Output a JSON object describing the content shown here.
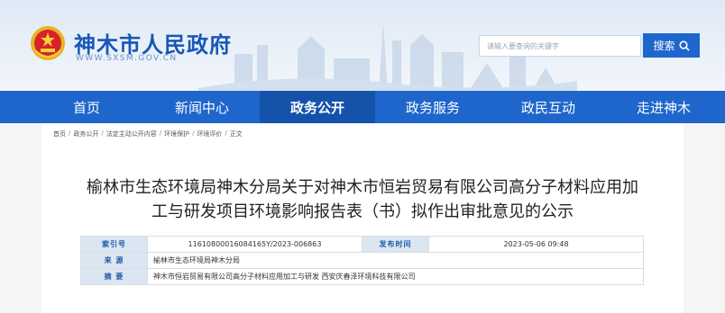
{
  "site": {
    "name": "神木市人民政府",
    "url": "WWW.SXSM.GOV.CN",
    "emblem_icon": "national-emblem-icon"
  },
  "search": {
    "placeholder": "请输入要查询的关键字",
    "button_label": "搜索",
    "icon": "search-icon"
  },
  "nav": {
    "items": [
      {
        "label": "首页"
      },
      {
        "label": "新闻中心"
      },
      {
        "label": "政务公开"
      },
      {
        "label": "政务服务"
      },
      {
        "label": "政民互动"
      },
      {
        "label": "走进神木"
      }
    ],
    "active_index": 2
  },
  "breadcrumb": {
    "items": [
      "首页",
      "政务公开",
      "法定主动公开内容",
      "环境保护",
      "环境评价",
      "正文"
    ],
    "separator": "/"
  },
  "article": {
    "title_line1": "榆林市生态环境局神木分局关于对神木市恒岩贸易有限公司高分子材料应用加",
    "title_line2": "工与研发项目环境影响报告表（书）拟作出审批意见的公示"
  },
  "meta": {
    "index_label": "索引号",
    "index_value": "11610800016084165Y/2023-006863",
    "date_label": "发布时间",
    "date_value": "2023-05-06 09:48",
    "source_label": "来  源",
    "source_value": "榆林市生态环境局神木分局",
    "summary_label": "摘  要",
    "summary_value": "神木市恒岩贸易有限公司高分子材料应用加工与研发 西安庆春泽环境科技有限公司"
  },
  "colors": {
    "primary": "#1f66cc",
    "nav_active": "#1553ab",
    "header_bg": "#dfe9f5"
  }
}
